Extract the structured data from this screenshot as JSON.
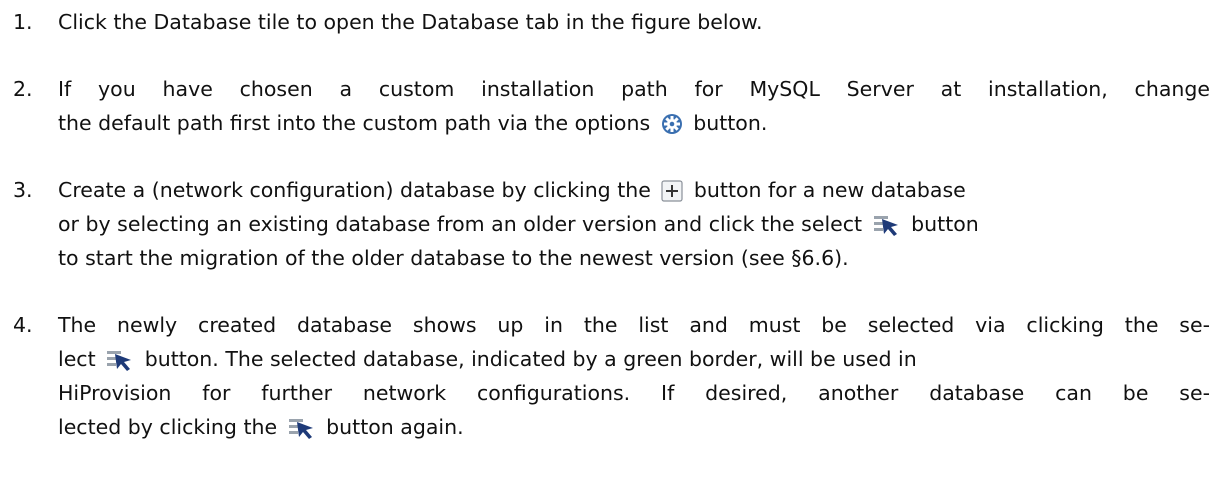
{
  "steps": [
    {
      "number": "1.",
      "lines": [
        "Click the Database tile to open the Database tab in the figure below."
      ]
    },
    {
      "number": "2.",
      "lines": [
        "If you have chosen a custom installation path for MySQL Server at installation, change",
        "the default path first into the custom path via the options",
        "button."
      ],
      "icons": [
        "gear-options-icon"
      ]
    },
    {
      "number": "3.",
      "lines": [
        "Create a (network configuration) database by clicking the",
        "button for a new database",
        "or by selecting an existing database from an older version and click the select",
        "button",
        "to start the migration of the older database to the newest version (see §6.6)."
      ],
      "icons": [
        "plus-add-icon",
        "select-cursor-icon"
      ]
    },
    {
      "number": "4.",
      "lines": [
        "The newly created database shows up in the list and must be selected via clicking the se-",
        "lect",
        "button. The selected database, indicated by a green border, will be used in",
        "HiProvision for further network configurations.  If desired, another database can be se-",
        "lected by clicking the",
        "button again."
      ],
      "icons": [
        "select-cursor-icon",
        "select-cursor-icon"
      ]
    }
  ],
  "colors": {
    "text": "#111111",
    "gear": "#3a6fb0",
    "cursor": "#1e3a78"
  }
}
